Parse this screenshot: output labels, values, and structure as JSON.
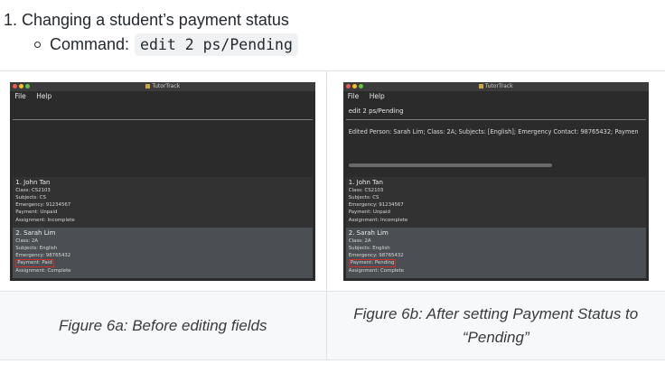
{
  "step": {
    "text": "1. Changing a student’s payment status"
  },
  "command": {
    "label": "Command:",
    "code": "edit 2 ps/Pending"
  },
  "figures": [
    {
      "window": {
        "title": "TutorTrack",
        "menu": [
          "File",
          "Help"
        ],
        "command_input": "",
        "result": ""
      },
      "students": [
        {
          "name": "1. John Tan",
          "class": "Class: CS2103",
          "subjects": "Subjects: CS",
          "emergency": "Emergency: 91234567",
          "payment": "Payment: Unpaid",
          "assignment": "Assignment: Incomplete"
        },
        {
          "name": "2. Sarah Lim",
          "class": "Class: 2A",
          "subjects": "Subjects: English",
          "emergency": "Emergency: 98765432",
          "payment": "Payment: Paid",
          "assignment": "Assignment: Complete"
        }
      ],
      "caption": "Figure 6a: Before editing fields"
    },
    {
      "window": {
        "title": "TutorTrack",
        "menu": [
          "File",
          "Help"
        ],
        "command_input": "edit 2 ps/Pending",
        "result": "Edited Person: Sarah Lim; Class: 2A; Subjects: [English]; Emergency Contact: 98765432; Paymen"
      },
      "students": [
        {
          "name": "1. John Tan",
          "class": "Class: CS2103",
          "subjects": "Subjects: CS",
          "emergency": "Emergency: 91234567",
          "payment": "Payment: Unpaid",
          "assignment": "Assignment: Incomplete"
        },
        {
          "name": "2. Sarah Lim",
          "class": "Class: 2A",
          "subjects": "Subjects: English",
          "emergency": "Emergency: 98765432",
          "payment": "Payment: Pending",
          "assignment": "Assignment: Complete"
        }
      ],
      "caption": "Figure 6b: After setting Payment Status to “Pending”"
    }
  ]
}
